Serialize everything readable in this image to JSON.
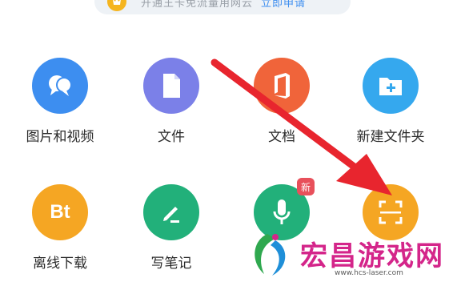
{
  "banner": {
    "text": "开通王卡免流量用网云",
    "link": "立即申请"
  },
  "tiles": [
    {
      "label": "图片和视频",
      "icon": "chat-bubbles-icon",
      "color": "#3d8ef0"
    },
    {
      "label": "文件",
      "icon": "document-icon",
      "color": "#7b80e8"
    },
    {
      "label": "文档",
      "icon": "office-icon",
      "color": "#f0643a"
    },
    {
      "label": "新建文件夹",
      "icon": "new-folder-icon",
      "color": "#35a8ee"
    },
    {
      "label": "离线下载",
      "icon": "bt-icon",
      "color": "#f5a623",
      "glyph": "Bt"
    },
    {
      "label": "写笔记",
      "icon": "pen-icon",
      "color": "#22b07a"
    },
    {
      "label": "",
      "icon": "microphone-icon",
      "color": "#22b07a",
      "badge": "新"
    },
    {
      "label": "",
      "icon": "scan-icon",
      "color": "#f5a623"
    }
  ],
  "watermark": {
    "title": "宏昌游戏网",
    "url": "www.hcs-laser.com"
  }
}
